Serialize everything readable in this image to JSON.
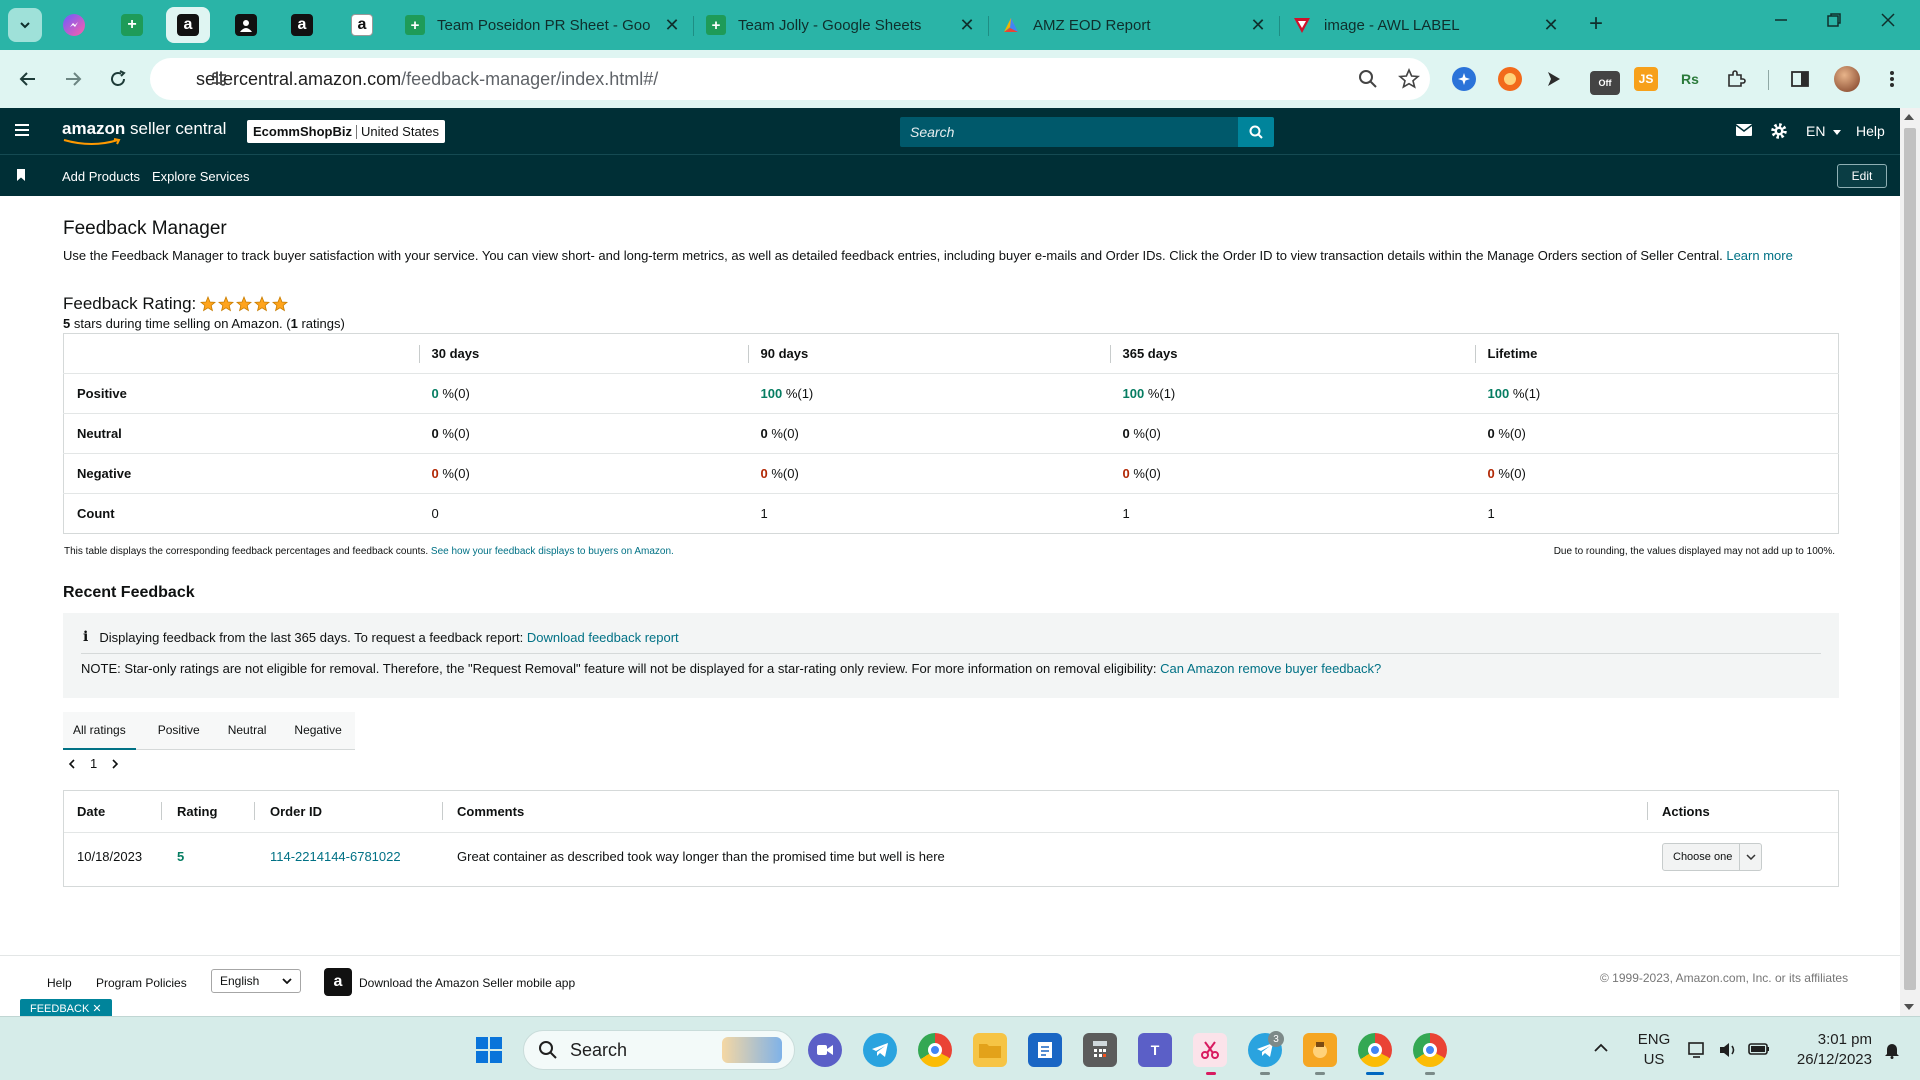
{
  "browser": {
    "tabs": [
      {
        "title": "Team Poseidon PR Sheet - Goo",
        "favicon": "sheets-icon"
      },
      {
        "title": "Team Jolly - Google Sheets",
        "favicon": "sheets-icon"
      },
      {
        "title": "AMZ EOD Report",
        "favicon": "report-icon"
      },
      {
        "title": "image - AWL LABEL",
        "favicon": "label-icon"
      }
    ],
    "close_glyph": "✕",
    "new_tab_glyph": "+",
    "url_host": "sellercentral.amazon.com",
    "url_path": "/feedback-manager/index.html#/",
    "ext_js_label": "JS",
    "ext_off_label": "Off",
    "ext_rs_label": "Rs"
  },
  "header": {
    "logo_brand": "amazon",
    "logo_product": "seller central",
    "store_name": "EcommShopBiz",
    "marketplace": "United States",
    "search_placeholder": "Search",
    "language": "EN",
    "help": "Help"
  },
  "subnav": {
    "links": [
      "Add Products",
      "Explore Services"
    ],
    "edit": "Edit"
  },
  "page": {
    "title": "Feedback Manager",
    "intro": "Use the Feedback Manager to track buyer satisfaction with your service. You can view short- and long-term metrics, as well as detailed feedback entries, including buyer e-mails and Order IDs. Click the Order ID to view transaction details within the Manage Orders section of Seller Central.",
    "learn_more": "Learn more",
    "rating_label": "Feedback Rating:",
    "rating_stars": 5,
    "rating_summary_stars": "5",
    "rating_summary_mid": " stars during time selling on Amazon. (",
    "rating_summary_count": "1",
    "rating_summary_end": " ratings)"
  },
  "metrics": {
    "columns": [
      "30 days",
      "90 days",
      "365 days",
      "Lifetime"
    ],
    "rows": [
      {
        "label": "Positive",
        "kind": "pos",
        "cells": [
          [
            "0",
            " %(0)"
          ],
          [
            "100",
            " %(1)"
          ],
          [
            "100",
            " %(1)"
          ],
          [
            "100",
            " %(1)"
          ]
        ]
      },
      {
        "label": "Neutral",
        "kind": "neu",
        "cells": [
          [
            "0",
            " %(0)"
          ],
          [
            "0",
            " %(0)"
          ],
          [
            "0",
            " %(0)"
          ],
          [
            "0",
            " %(0)"
          ]
        ]
      },
      {
        "label": "Negative",
        "kind": "neg",
        "cells": [
          [
            "0",
            " %(0)"
          ],
          [
            "0",
            " %(0)"
          ],
          [
            "0",
            " %(0)"
          ],
          [
            "0",
            " %(0)"
          ]
        ]
      },
      {
        "label": "Count",
        "kind": "count",
        "cells": [
          [
            "0",
            ""
          ],
          [
            "1",
            ""
          ],
          [
            "1",
            ""
          ],
          [
            "1",
            ""
          ]
        ]
      }
    ],
    "note": "This table displays the corresponding feedback percentages and feedback counts.",
    "note_link": "See how your feedback displays to buyers on Amazon.",
    "note_right": "Due to rounding, the values displayed may not add up to 100%."
  },
  "recent": {
    "title": "Recent Feedback",
    "info_icon": "i",
    "info_text": "Displaying feedback from the last 365 days. To request a feedback report:",
    "info_link": "Download feedback report",
    "note_text": "NOTE: Star-only ratings are not eligible for removal. Therefore, the \"Request Removal\" feature will not be displayed for a star-rating only review. For more information on removal eligibility:",
    "note_link": "Can Amazon remove buyer feedback?",
    "tabs": [
      "All ratings",
      "Positive",
      "Neutral",
      "Negative"
    ],
    "active_tab": 0,
    "page": "1",
    "columns": {
      "date": "Date",
      "rating": "Rating",
      "order": "Order ID",
      "comments": "Comments",
      "actions": "Actions"
    },
    "rows": [
      {
        "date": "10/18/2023",
        "rating": "5",
        "order_id": "114-2214144-6781022",
        "comment": "Great container as described took way longer than the promised time but well is here",
        "action": "Choose one"
      }
    ]
  },
  "footer": {
    "help": "Help",
    "policies": "Program Policies",
    "language": "English",
    "app_text": "Download the Amazon Seller mobile app",
    "copyright": "© 1999-2023, Amazon.com, Inc. or its affiliates",
    "feedback_tag": "FEEDBACK ✕"
  },
  "taskbar": {
    "search": "Search",
    "lang_top": "ENG",
    "lang_bottom": "US",
    "time": "3:01 pm",
    "date": "26/12/2023",
    "telegram_badge": "3"
  },
  "colors": {
    "teal_tab": "#2ab4a7",
    "header": "#002f36",
    "link": "#007185",
    "positive": "#067d62",
    "negative": "#b12704",
    "star": "#ffa41c"
  }
}
